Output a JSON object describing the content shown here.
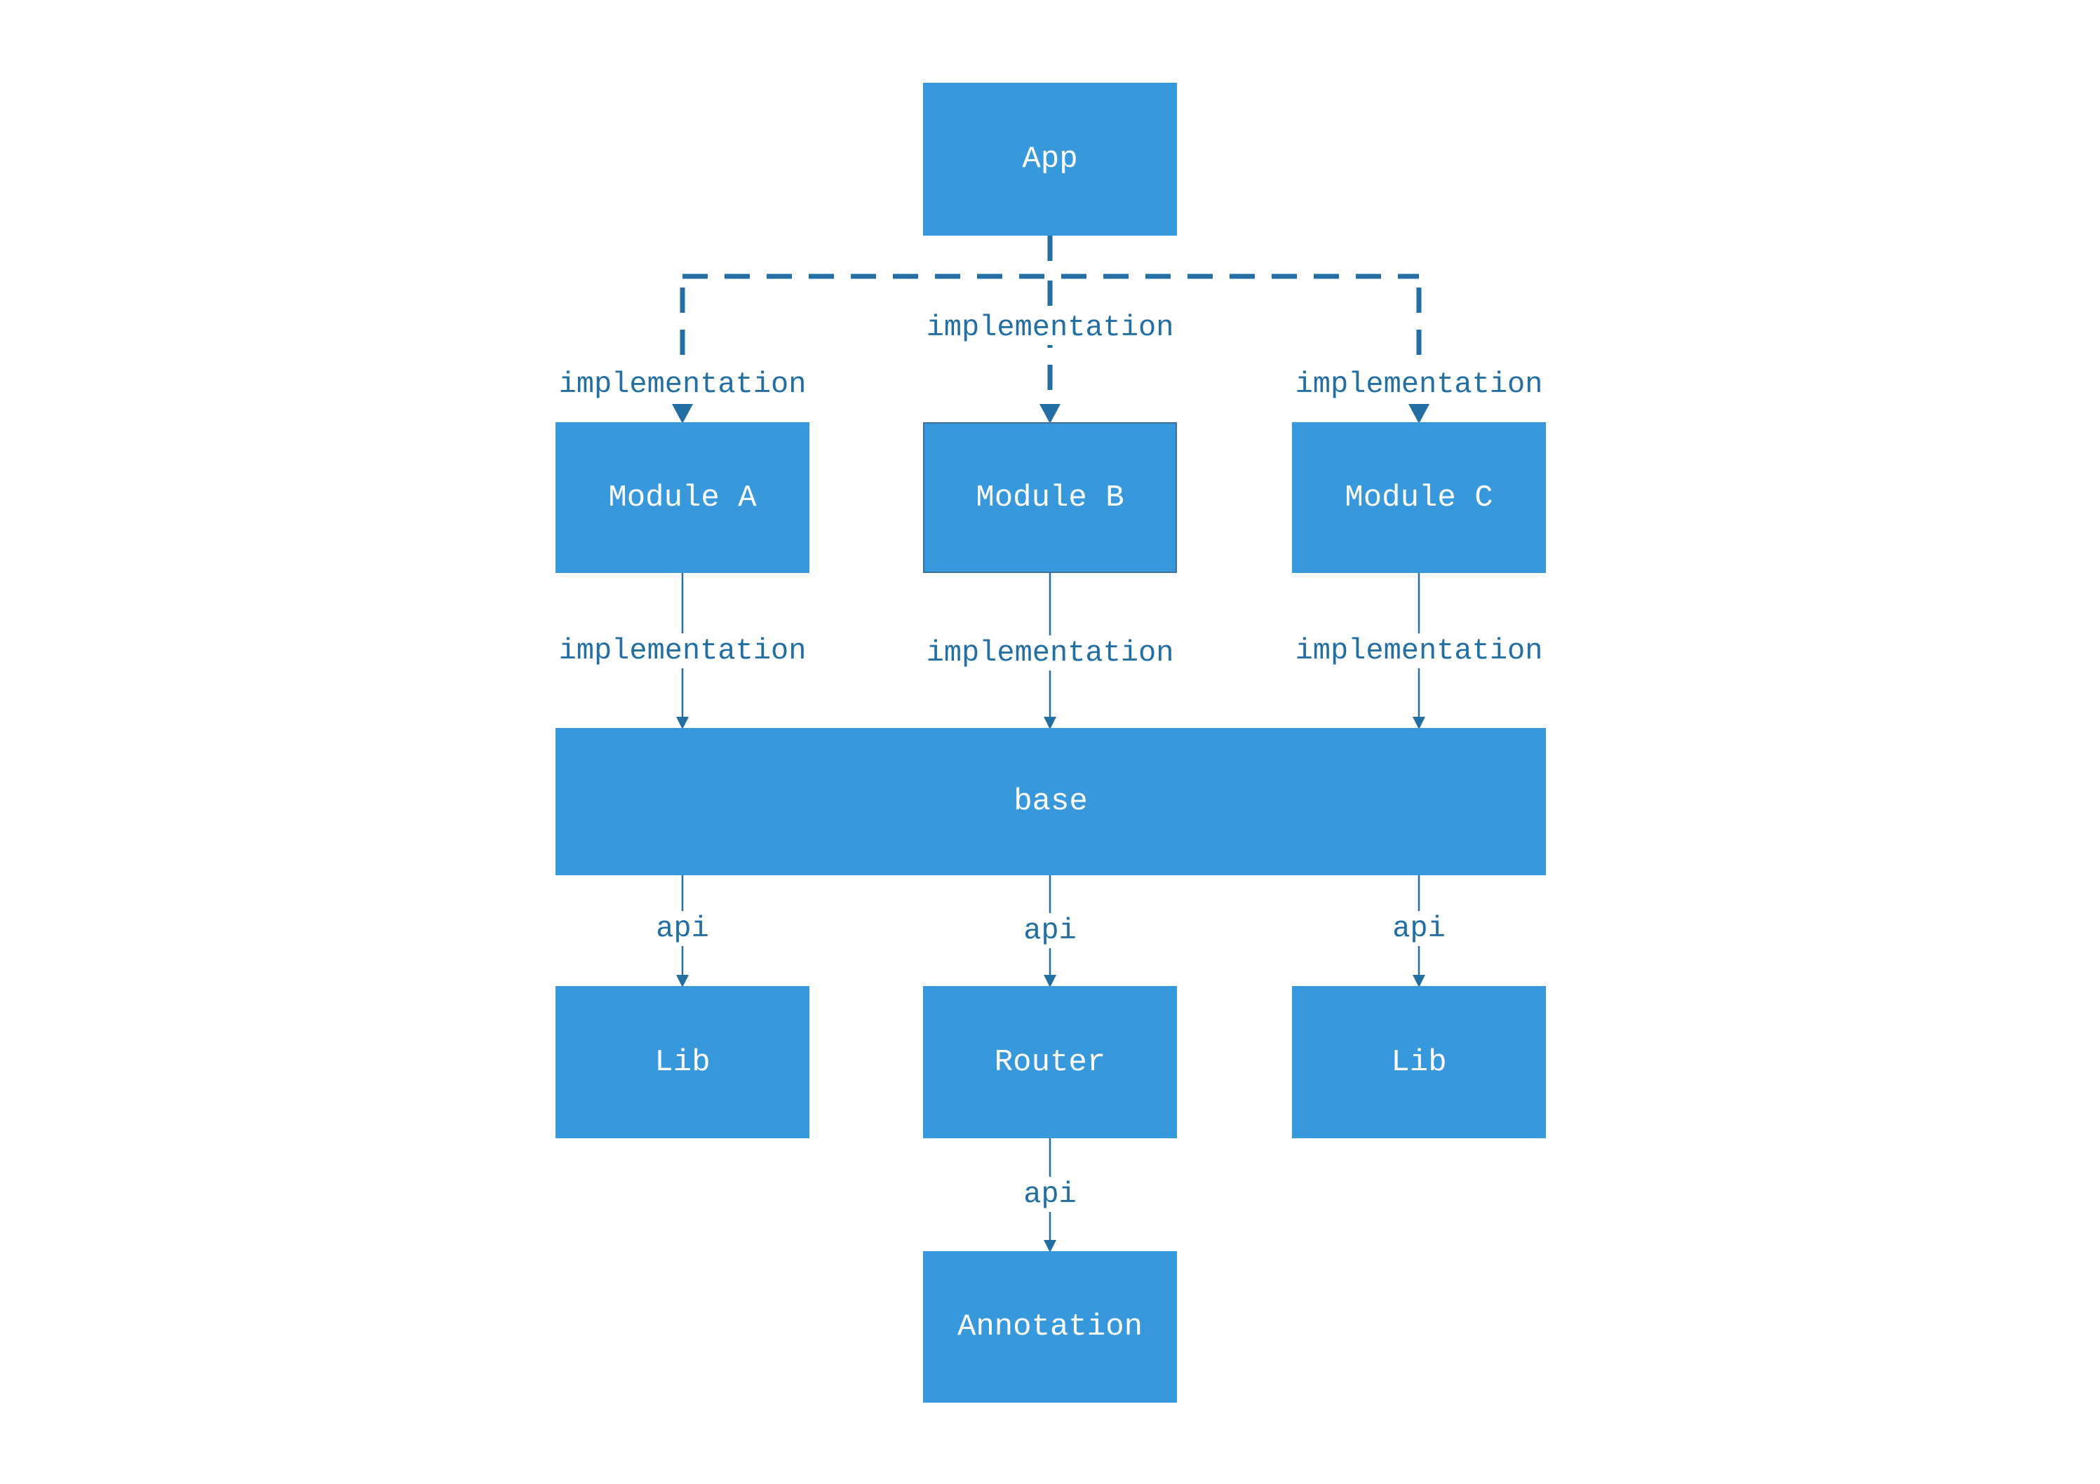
{
  "diagram": {
    "colors": {
      "node_fill": "#3798db",
      "node_text": "#ffffff",
      "edge": "#236ea3",
      "label": "#236ea3"
    },
    "nodes": {
      "app": "App",
      "module_a": "Module A",
      "module_b": "Module B",
      "module_c": "Module C",
      "base": "base",
      "lib_left": "Lib",
      "router": "Router",
      "lib_right": "Lib",
      "annotation": "Annotation"
    },
    "edges": [
      {
        "from": "App",
        "to": "Module A",
        "label": "implementation",
        "style": "dashed"
      },
      {
        "from": "App",
        "to": "Module B",
        "label": "implementation",
        "style": "dashed"
      },
      {
        "from": "App",
        "to": "Module C",
        "label": "implementation",
        "style": "dashed"
      },
      {
        "from": "Module A",
        "to": "base",
        "label": "implementation",
        "style": "solid"
      },
      {
        "from": "Module B",
        "to": "base",
        "label": "implementation",
        "style": "solid"
      },
      {
        "from": "Module C",
        "to": "base",
        "label": "implementation",
        "style": "solid"
      },
      {
        "from": "base",
        "to": "Lib",
        "label": "api",
        "style": "solid"
      },
      {
        "from": "base",
        "to": "Router",
        "label": "api",
        "style": "solid"
      },
      {
        "from": "base",
        "to": "Lib",
        "label": "api",
        "style": "solid"
      },
      {
        "from": "Router",
        "to": "Annotation",
        "label": "api",
        "style": "solid"
      }
    ]
  }
}
